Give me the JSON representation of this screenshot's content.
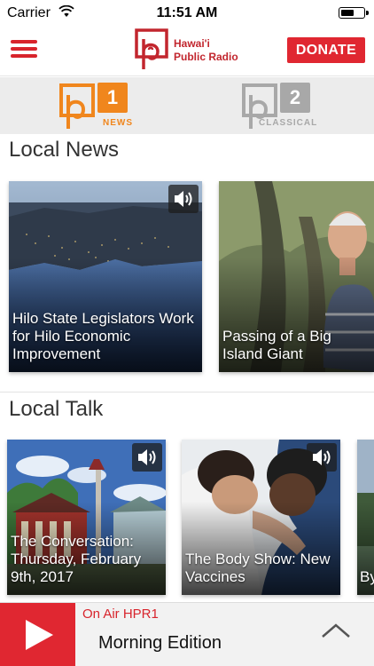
{
  "status_bar": {
    "carrier": "Carrier",
    "time": "11:51 AM"
  },
  "header": {
    "logo_line1": "Hawai'i",
    "logo_line2": "Public Radio",
    "donate_label": "DONATE",
    "accent_color": "#d8242c"
  },
  "stations": [
    {
      "number": "1",
      "label": "NEWS",
      "color": "#f0861d",
      "selected": true
    },
    {
      "number": "2",
      "label": "CLASSICAL",
      "color": "#a8a8a8",
      "selected": false
    }
  ],
  "local_news": {
    "title": "Local News",
    "cards": [
      {
        "caption": "Hilo State Legislators Work for Hilo Economic Improvement",
        "has_audio": true
      },
      {
        "caption": "Passing of a Big Island Giant",
        "has_audio": false
      }
    ]
  },
  "local_talk": {
    "title": "Local Talk",
    "cards": [
      {
        "caption": "The Conversation: Thursday, February 9th, 2017",
        "has_audio": true
      },
      {
        "caption": "The Body Show: New Vaccines",
        "has_audio": true
      },
      {
        "caption": "By Po Ag",
        "has_audio": false
      }
    ]
  },
  "player": {
    "on_air": "On Air HPR1",
    "program": "Morning Edition"
  },
  "icons": [
    "wifi-icon",
    "battery-icon",
    "menu-icon",
    "audio-icon",
    "play-icon",
    "chevron-up-icon"
  ]
}
